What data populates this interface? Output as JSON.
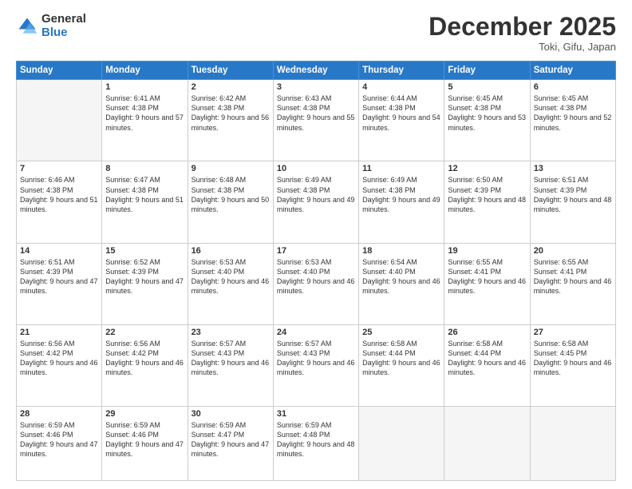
{
  "logo": {
    "general": "General",
    "blue": "Blue"
  },
  "header": {
    "month": "December 2025",
    "location": "Toki, Gifu, Japan"
  },
  "days_of_week": [
    "Sunday",
    "Monday",
    "Tuesday",
    "Wednesday",
    "Thursday",
    "Friday",
    "Saturday"
  ],
  "weeks": [
    [
      {
        "day": null
      },
      {
        "day": 1,
        "sunrise": "6:41 AM",
        "sunset": "4:38 PM",
        "daylight": "9 hours and 57 minutes."
      },
      {
        "day": 2,
        "sunrise": "6:42 AM",
        "sunset": "4:38 PM",
        "daylight": "9 hours and 56 minutes."
      },
      {
        "day": 3,
        "sunrise": "6:43 AM",
        "sunset": "4:38 PM",
        "daylight": "9 hours and 55 minutes."
      },
      {
        "day": 4,
        "sunrise": "6:44 AM",
        "sunset": "4:38 PM",
        "daylight": "9 hours and 54 minutes."
      },
      {
        "day": 5,
        "sunrise": "6:45 AM",
        "sunset": "4:38 PM",
        "daylight": "9 hours and 53 minutes."
      },
      {
        "day": 6,
        "sunrise": "6:45 AM",
        "sunset": "4:38 PM",
        "daylight": "9 hours and 52 minutes."
      }
    ],
    [
      {
        "day": 7,
        "sunrise": "6:46 AM",
        "sunset": "4:38 PM",
        "daylight": "9 hours and 51 minutes."
      },
      {
        "day": 8,
        "sunrise": "6:47 AM",
        "sunset": "4:38 PM",
        "daylight": "9 hours and 51 minutes."
      },
      {
        "day": 9,
        "sunrise": "6:48 AM",
        "sunset": "4:38 PM",
        "daylight": "9 hours and 50 minutes."
      },
      {
        "day": 10,
        "sunrise": "6:49 AM",
        "sunset": "4:38 PM",
        "daylight": "9 hours and 49 minutes."
      },
      {
        "day": 11,
        "sunrise": "6:49 AM",
        "sunset": "4:38 PM",
        "daylight": "9 hours and 49 minutes."
      },
      {
        "day": 12,
        "sunrise": "6:50 AM",
        "sunset": "4:39 PM",
        "daylight": "9 hours and 48 minutes."
      },
      {
        "day": 13,
        "sunrise": "6:51 AM",
        "sunset": "4:39 PM",
        "daylight": "9 hours and 48 minutes."
      }
    ],
    [
      {
        "day": 14,
        "sunrise": "6:51 AM",
        "sunset": "4:39 PM",
        "daylight": "9 hours and 47 minutes."
      },
      {
        "day": 15,
        "sunrise": "6:52 AM",
        "sunset": "4:39 PM",
        "daylight": "9 hours and 47 minutes."
      },
      {
        "day": 16,
        "sunrise": "6:53 AM",
        "sunset": "4:40 PM",
        "daylight": "9 hours and 46 minutes."
      },
      {
        "day": 17,
        "sunrise": "6:53 AM",
        "sunset": "4:40 PM",
        "daylight": "9 hours and 46 minutes."
      },
      {
        "day": 18,
        "sunrise": "6:54 AM",
        "sunset": "4:40 PM",
        "daylight": "9 hours and 46 minutes."
      },
      {
        "day": 19,
        "sunrise": "6:55 AM",
        "sunset": "4:41 PM",
        "daylight": "9 hours and 46 minutes."
      },
      {
        "day": 20,
        "sunrise": "6:55 AM",
        "sunset": "4:41 PM",
        "daylight": "9 hours and 46 minutes."
      }
    ],
    [
      {
        "day": 21,
        "sunrise": "6:56 AM",
        "sunset": "4:42 PM",
        "daylight": "9 hours and 46 minutes."
      },
      {
        "day": 22,
        "sunrise": "6:56 AM",
        "sunset": "4:42 PM",
        "daylight": "9 hours and 46 minutes."
      },
      {
        "day": 23,
        "sunrise": "6:57 AM",
        "sunset": "4:43 PM",
        "daylight": "9 hours and 46 minutes."
      },
      {
        "day": 24,
        "sunrise": "6:57 AM",
        "sunset": "4:43 PM",
        "daylight": "9 hours and 46 minutes."
      },
      {
        "day": 25,
        "sunrise": "6:58 AM",
        "sunset": "4:44 PM",
        "daylight": "9 hours and 46 minutes."
      },
      {
        "day": 26,
        "sunrise": "6:58 AM",
        "sunset": "4:44 PM",
        "daylight": "9 hours and 46 minutes."
      },
      {
        "day": 27,
        "sunrise": "6:58 AM",
        "sunset": "4:45 PM",
        "daylight": "9 hours and 46 minutes."
      }
    ],
    [
      {
        "day": 28,
        "sunrise": "6:59 AM",
        "sunset": "4:46 PM",
        "daylight": "9 hours and 47 minutes."
      },
      {
        "day": 29,
        "sunrise": "6:59 AM",
        "sunset": "4:46 PM",
        "daylight": "9 hours and 47 minutes."
      },
      {
        "day": 30,
        "sunrise": "6:59 AM",
        "sunset": "4:47 PM",
        "daylight": "9 hours and 47 minutes."
      },
      {
        "day": 31,
        "sunrise": "6:59 AM",
        "sunset": "4:48 PM",
        "daylight": "9 hours and 48 minutes."
      },
      {
        "day": null
      },
      {
        "day": null
      },
      {
        "day": null
      }
    ]
  ]
}
